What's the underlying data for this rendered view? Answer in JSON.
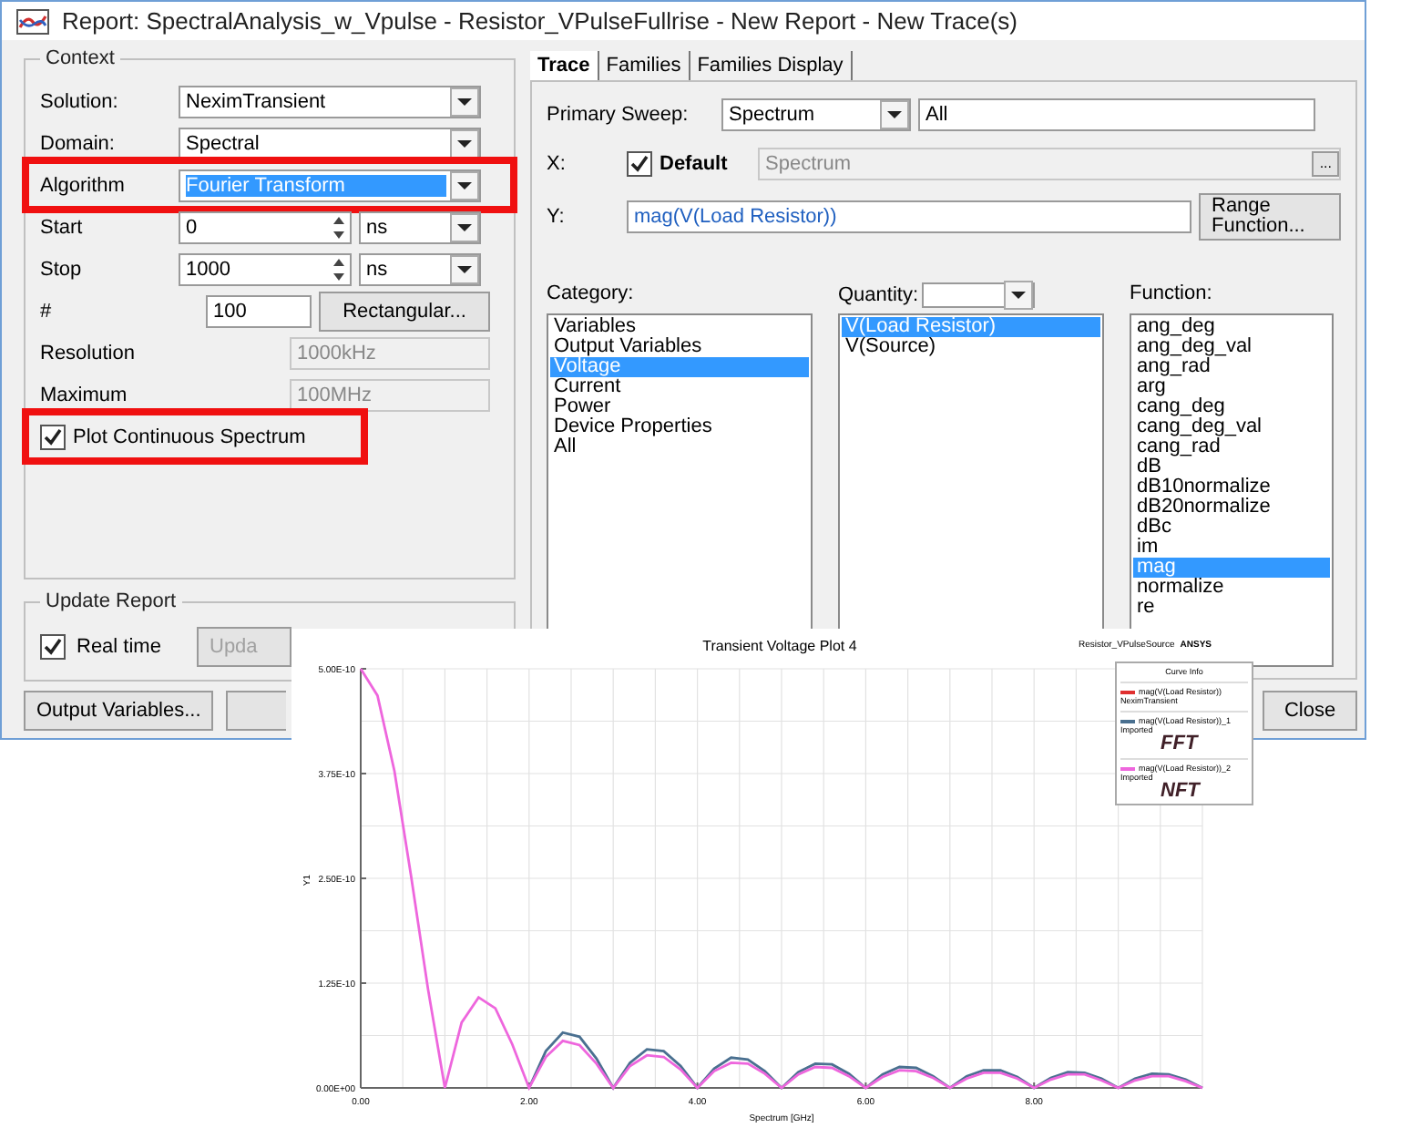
{
  "window": {
    "title": "Report: SpectralAnalysis_w_Vpulse - Resistor_VPulseFullrise - New Report - New Trace(s)"
  },
  "context": {
    "title": "Context",
    "fields": [
      {
        "kind": "dropdown",
        "label": "Solution:",
        "value": "NeximTransient",
        "focused": false,
        "highlighted": false
      },
      {
        "kind": "dropdown",
        "label": "Domain:",
        "value": "Spectral",
        "focused": false,
        "highlighted": false
      },
      {
        "kind": "dropdown",
        "label": "Algorithm",
        "value": "Fourier Transform",
        "focused": true,
        "highlighted": true
      },
      {
        "kind": "spin",
        "label": "Start",
        "value": "0",
        "unit": "ns",
        "highlighted": false
      },
      {
        "kind": "spin",
        "label": "Stop",
        "value": "1000",
        "unit": "ns",
        "highlighted": false
      },
      {
        "kind": "count",
        "label": "#",
        "value": "100",
        "button": "Rectangular...",
        "highlighted": false
      },
      {
        "kind": "readonly",
        "label": "Resolution",
        "value": "1000kHz",
        "disabled": true,
        "highlighted": false
      },
      {
        "kind": "readonly",
        "label": "Maximum",
        "value": "100MHz",
        "disabled": true,
        "highlighted": false
      },
      {
        "kind": "checkbox",
        "label": "Plot Continuous Spectrum",
        "checked": true,
        "highlighted": true
      }
    ]
  },
  "update_report": {
    "title": "Update Report",
    "realtime": {
      "label": "Real time",
      "checked": true
    },
    "button": {
      "label": "Upda",
      "disabled": true
    }
  },
  "bottom_buttons": [
    "Output Variables..."
  ],
  "tabs": [
    {
      "label": "Trace",
      "selected": true
    },
    {
      "label": "Families",
      "selected": false
    },
    {
      "label": "Families Display",
      "selected": false
    }
  ],
  "primary_sweep": {
    "label": "Primary Sweep:",
    "value": "Spectrum",
    "range": "All"
  },
  "x_axis": {
    "label": "X:",
    "default_label": "Default",
    "checked": true,
    "value": "Spectrum",
    "disabled": true,
    "browse": "..."
  },
  "y_axis": {
    "label": "Y:",
    "value": "mag(V(Load Resistor))",
    "button": "Range Function..."
  },
  "category": {
    "label": "Category:",
    "items": [
      {
        "label": "Variables",
        "selected": false
      },
      {
        "label": "Output Variables",
        "selected": false
      },
      {
        "label": "Voltage",
        "selected": true
      },
      {
        "label": "Current",
        "selected": false
      },
      {
        "label": "Power",
        "selected": false
      },
      {
        "label": "Device Properties",
        "selected": false
      },
      {
        "label": "All",
        "selected": false
      }
    ]
  },
  "quantity": {
    "label": "Quantity:",
    "items": [
      {
        "label": "V(Load Resistor)",
        "selected": true
      },
      {
        "label": "V(Source)",
        "selected": false
      }
    ]
  },
  "function": {
    "label": "Function:",
    "items": [
      {
        "label": "ang_deg",
        "selected": false
      },
      {
        "label": "ang_deg_val",
        "selected": false
      },
      {
        "label": "ang_rad",
        "selected": false
      },
      {
        "label": "arg",
        "selected": false
      },
      {
        "label": "cang_deg",
        "selected": false
      },
      {
        "label": "cang_deg_val",
        "selected": false
      },
      {
        "label": "cang_rad",
        "selected": false
      },
      {
        "label": "dB",
        "selected": false
      },
      {
        "label": "dB10normalize",
        "selected": false
      },
      {
        "label": "dB20normalize",
        "selected": false
      },
      {
        "label": "dBc",
        "selected": false
      },
      {
        "label": "im",
        "selected": false
      },
      {
        "label": "mag",
        "selected": true
      },
      {
        "label": "normalize",
        "selected": false
      },
      {
        "label": "re",
        "selected": false
      }
    ]
  },
  "close_button": "Close",
  "plot": {
    "design": "Resistor_VPulseSource",
    "brand": "ANSYS",
    "legend": {
      "title": "Curve Info",
      "entries": [
        {
          "name": "mag(V(Load Resistor))",
          "color": "#e03030",
          "source": "NeximTransient"
        },
        {
          "name": "mag(V(Load Resistor))_1",
          "color": "#4a7090",
          "source": "Imported",
          "note": "FFT"
        },
        {
          "name": "mag(V(Load Resistor))_2",
          "color": "#ee66dd",
          "source": "Imported",
          "note": "NFT"
        }
      ]
    },
    "chart_data": {
      "type": "line",
      "title": "Transient Voltage Plot 4",
      "xlabel": "Spectrum [GHz]",
      "ylabel": "Y1",
      "grid": true,
      "x": [
        0,
        0.2,
        0.4,
        0.6,
        0.8,
        1,
        1.2,
        1.4,
        1.6,
        1.8,
        2,
        2.2,
        2.4,
        2.6,
        2.8,
        3,
        3.2,
        3.4,
        3.6,
        3.8,
        4,
        4.2,
        4.4,
        4.6,
        4.8,
        5,
        5.2,
        5.4,
        5.6,
        5.8,
        6,
        6.2,
        6.4,
        6.6,
        6.8,
        7,
        7.2,
        7.4,
        7.6,
        7.8,
        8,
        8.2,
        8.4,
        8.6,
        8.8,
        9,
        9.2,
        9.4,
        9.6,
        9.8,
        10
      ],
      "series": [
        {
          "color": "#4a7090",
          "values": [
            null,
            null,
            null,
            null,
            null,
            null,
            null,
            null,
            null,
            null,
            0,
            4.4e-11,
            6.6e-11,
            6.1e-11,
            3.5e-11,
            0,
            3e-11,
            4.6e-11,
            4.4e-11,
            2.6e-11,
            0,
            2.3e-11,
            3.6e-11,
            3.4e-11,
            2e-11,
            0,
            1.9e-11,
            2.9e-11,
            2.8e-11,
            1.7e-11,
            0,
            1.6e-11,
            2.5e-11,
            2.4e-11,
            1.4e-11,
            0,
            1.4e-11,
            2.1e-11,
            2.1e-11,
            1.3e-11,
            0,
            1.2e-11,
            1.9e-11,
            1.8e-11,
            1.1e-11,
            0,
            1.1e-11,
            1.7e-11,
            1.6e-11,
            1e-11,
            0
          ]
        },
        {
          "color": "#ee66dd",
          "values": [
            5e-10,
            4.68e-10,
            3.78e-10,
            2.52e-10,
            1.17e-10,
            0,
            7.8e-11,
            1.08e-10,
            9.5e-11,
            5.2e-11,
            0,
            3.7e-11,
            5.6e-11,
            5.1e-11,
            2.9e-11,
            0,
            2.6e-11,
            3.9e-11,
            3.7e-11,
            2.2e-11,
            0,
            2e-11,
            3e-11,
            2.9e-11,
            1.7e-11,
            0,
            1.6e-11,
            2.5e-11,
            2.4e-11,
            1.4e-11,
            0,
            1.3e-11,
            2.1e-11,
            2e-11,
            1.2e-11,
            0,
            1.1e-11,
            1.8e-11,
            1.8e-11,
            1.1e-11,
            0,
            1e-11,
            1.6e-11,
            1.6e-11,
            9e-12,
            0,
            9e-12,
            1.4e-11,
            1.4e-11,
            8e-12,
            0
          ]
        }
      ],
      "xlim": [
        0,
        10
      ],
      "ylim": [
        0,
        5e-10
      ],
      "xticks": [
        {
          "value": 0,
          "label": "0.00"
        },
        {
          "value": 2,
          "label": "2.00"
        },
        {
          "value": 4,
          "label": "4.00"
        },
        {
          "value": 6,
          "label": "6.00"
        },
        {
          "value": 8,
          "label": "8.00"
        }
      ],
      "yticks": [
        {
          "value": 0,
          "label": "0.00E+00"
        },
        {
          "value": 1.25e-10,
          "label": "1.25E-10"
        },
        {
          "value": 2.5e-10,
          "label": "2.50E-10"
        },
        {
          "value": 3.75e-10,
          "label": "3.75E-10"
        },
        {
          "value": 5e-10,
          "label": "5.00E-10"
        }
      ]
    }
  }
}
